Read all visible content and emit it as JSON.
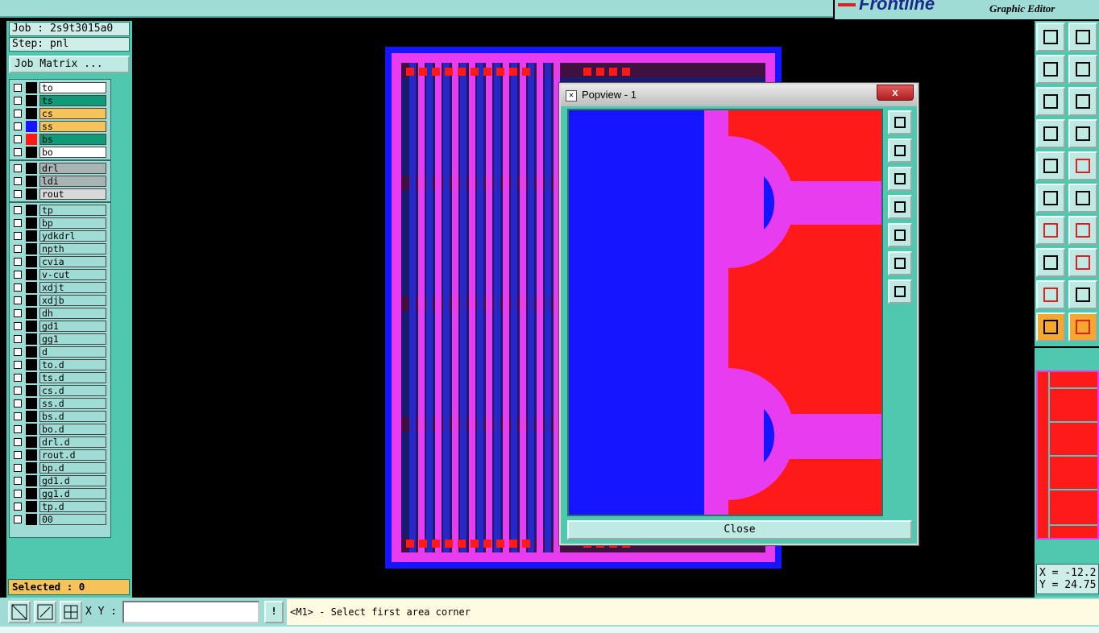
{
  "app": {
    "brand": "Frontline",
    "subtitle": "Graphic Editor"
  },
  "job": {
    "job_line": "Job : 2s9t3015a0",
    "step_line": "Step: pnl",
    "matrix_button": "Job Matrix ..."
  },
  "layers": {
    "group1": [
      {
        "name": "to",
        "color": "#ffffff",
        "swatch": "#000000"
      },
      {
        "name": "ts",
        "color": "#0f9a78",
        "swatch": "#000000"
      },
      {
        "name": "cs",
        "color": "#f5c35a",
        "swatch": "#000000"
      },
      {
        "name": "ss",
        "color": "#f5c35a",
        "swatch": "#1515ff"
      },
      {
        "name": "bs",
        "color": "#0f9a78",
        "swatch": "#ff1a1a"
      },
      {
        "name": "bo",
        "color": "#ffffff",
        "swatch": "#000000"
      }
    ],
    "group2": [
      {
        "name": "drl",
        "color": "#a8b4b2"
      },
      {
        "name": "ldi",
        "color": "#a8b4b2"
      },
      {
        "name": "rout",
        "color": "#d8d8d8"
      }
    ],
    "group3": [
      "tp",
      "bp",
      "ydkdrl",
      "npth",
      "cvia",
      "v-cut",
      "xdjt",
      "xdjb",
      "dh",
      "gd1",
      "gg1",
      "d",
      "to.d",
      "ts.d",
      "cs.d",
      "ss.d",
      "bs.d",
      "bo.d",
      "drl.d",
      "rout.d",
      "bp.d",
      "gd1.d",
      "gg1.d",
      "tp.d",
      "00"
    ]
  },
  "selected": "Selected : 0",
  "popview": {
    "title": "Popview - 1",
    "close_x": "x",
    "close_button": "Close"
  },
  "coords": {
    "x": "X = -12.2",
    "y": "Y = 24.75"
  },
  "bottom": {
    "xy_label": "X Y :",
    "xy_value": "",
    "warn": "!",
    "prompt": "<M1> - Select first area corner"
  },
  "colors": {
    "teal": "#50c8b0",
    "board_blue": "#1515ff",
    "magenta": "#e83cf0",
    "copper_red": "#ff1a1a",
    "selected_orange": "#f5c35a"
  }
}
